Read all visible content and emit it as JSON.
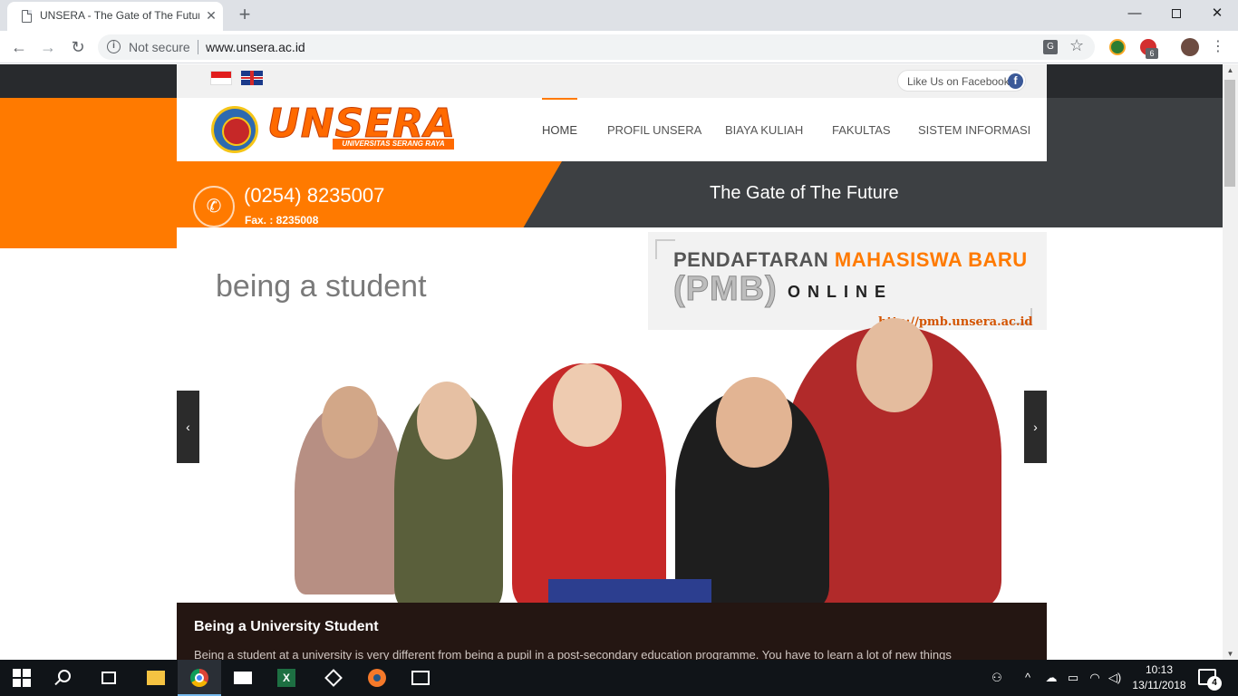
{
  "browser": {
    "tab_title": "UNSERA - The Gate of The Future",
    "tab_close": "✕",
    "new_tab": "+",
    "window_min": "—",
    "window_close": "✕",
    "nav_back": "←",
    "nav_forward": "→",
    "nav_reload": "↻",
    "security_label": "Not secure",
    "url": "www.unsera.ac.id",
    "star": "☆",
    "menu": "⋮",
    "extension_badge": "6"
  },
  "topbar": {
    "facebook_like": "Like Us on Facebook",
    "facebook_glyph": "f"
  },
  "header": {
    "logo_text": "UNSERA",
    "logo_subtitle": "UNIVERSITAS SERANG RAYA",
    "nav": [
      "HOME",
      "PROFIL UNSERA",
      "BIAYA KULIAH",
      "FAKULTAS",
      "SISTEM INFORMASI"
    ],
    "active_nav": "HOME",
    "accent_color": "#ff7a00"
  },
  "contact": {
    "phone_icon": "✆",
    "phone": "(0254) 8235007",
    "fax": "Fax. : 8235008"
  },
  "tagline": "The Gate of The Future",
  "slider": {
    "heading": "being a student",
    "pmb_line1_a": "PENDAFTARAN ",
    "pmb_line1_b": "MAHASISWA BARU",
    "pmb_abbr": "(PMB)",
    "pmb_online": "ONLINE",
    "pmb_url": "http://pmb.unsera.ac.id",
    "prev": "‹",
    "next": "›"
  },
  "caption": {
    "title": "Being a University Student",
    "text": "Being a student at a university is very different from being a pupil in a post-secondary education programme. You have to learn a lot of new things"
  },
  "taskbar": {
    "excel_letter": "X",
    "clock_time": "10:13",
    "clock_date": "13/11/2018",
    "notification_count": "4"
  }
}
